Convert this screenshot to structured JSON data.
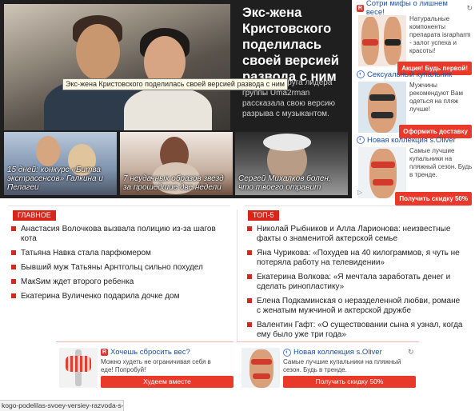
{
  "hero": {
    "title": "Экс-жена Кристовского поделилась своей версией развода с ним",
    "text": "Бывшая супруга лидера группы Uma2rman рассказала свою версию разрыва с музыкантом.",
    "tooltip": "Экс-жена Кристовского поделилась своей версией развода с ним"
  },
  "thumbs": [
    {
      "caption": "15 дней: конкурс «Битва экстрасенсов» Галкина и Пелагеи"
    },
    {
      "caption": "7 неудачных образов звезд за прошедшие две недели"
    },
    {
      "caption": "Сергей Михалков болен, что твоего отравит"
    }
  ],
  "right_ads": [
    {
      "title": "Сотри мифы о лишнем весе!",
      "icon": "ad-icon",
      "text": "Натуральные компоненты препарата israpharm - залог успеха и красоты!",
      "button": "Акция! Будь первой!"
    },
    {
      "title": "Сексуальный купальник",
      "icon": "sponsor-icon",
      "text": "Мужчины рекомендуют Вам одеться на пляж лучше!",
      "button": "Оформить доставку"
    },
    {
      "title": "Новая коллекция s.Oliver",
      "icon": "sponsor-icon",
      "text": "Самые лучшие купальники на пляжный сезон. Будь в тренде.",
      "button": "Получить скидку 50%"
    }
  ],
  "main_news": {
    "badge": "ГЛАВНОЕ",
    "items": [
      "Анастасия Волочкова вызвала полицию из-за шагов кота",
      "Татьяна Навка стала парфюмером",
      "Бывший муж Татьяны Арнтгольц сильно похудел",
      "МакSим ждет второго ребенка",
      "Екатерина Вуличенко подарила дочке дом"
    ]
  },
  "top5": {
    "badge": "ТОП-5",
    "items": [
      "Николай Рыбников и Алла Ларионова: неизвестные факты о знаменитой актерской семье",
      "Яна Чурикова: «Похудев на 40 килограммов, я чуть не потеряла работу на телевидении»",
      "Екатерина Волкова: «Я мечтала заработать денег и сделать ринопластику»",
      "Елена Подкаминская о неразделенной любви, романе с женатым мужчиной и актерской дружбе",
      "Валентин Гафт: «О существовании сына я узнал, когда ему было уже три года»"
    ]
  },
  "bottom_ads": [
    {
      "title": "Хочешь сбросить вес?",
      "text": "Можно худеть не ограничивая себя в еде! Попробуй!",
      "button": "Худеем вместе"
    },
    {
      "title": "Новая коллекция s.Oliver",
      "text": "Самые лучшие купальники на пляжный сезон. Будь в тренде.",
      "button": "Получить скидку 50%"
    }
  ],
  "status_bar": {
    "url": "kogo-podelilas-svoey-versiey-razvoda-s-nim"
  },
  "colors": {
    "accent": "#d7261c",
    "link": "#1d4f9f",
    "button": "#e8392a",
    "hero_bg": "#1f1f1f"
  }
}
